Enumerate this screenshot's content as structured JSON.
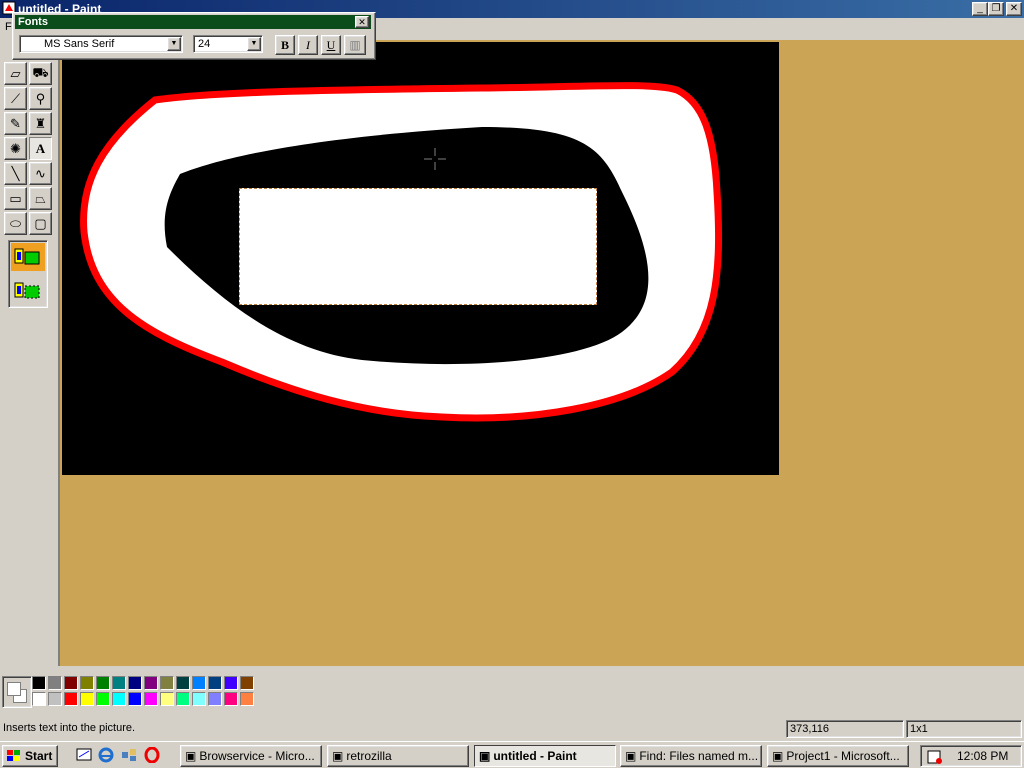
{
  "window": {
    "title": "untitled - Paint",
    "menu_first_letter": "F"
  },
  "fonts_toolbar": {
    "title": "Fonts",
    "font_name": "MS Sans Serif",
    "font_size": "24",
    "bold_label": "B",
    "italic_label": "I",
    "underline_label": "U"
  },
  "palette": {
    "row1": [
      "#000000",
      "#808080",
      "#800000",
      "#808000",
      "#008000",
      "#008080",
      "#000080",
      "#800080",
      "#808040",
      "#004040",
      "#0080ff",
      "#004080",
      "#4000ff",
      "#804000"
    ],
    "row2": [
      "#ffffff",
      "#c0c0c0",
      "#ff0000",
      "#ffff00",
      "#00ff00",
      "#00ffff",
      "#0000ff",
      "#ff00ff",
      "#ffff80",
      "#00ff80",
      "#80ffff",
      "#8080ff",
      "#ff0080",
      "#ff8040"
    ]
  },
  "status": {
    "message": "Inserts text into the picture.",
    "coords": "373,116",
    "size": "1x1"
  },
  "taskbar": {
    "start_label": "Start",
    "tasks": [
      {
        "label": "Browservice - Micro...",
        "active": false
      },
      {
        "label": "retrozilla",
        "active": false
      },
      {
        "label": "untitled - Paint",
        "active": true
      },
      {
        "label": "Find: Files named m...",
        "active": false
      },
      {
        "label": "Project1 - Microsoft...",
        "active": false
      }
    ],
    "clock": "12:08 PM"
  },
  "colors": {
    "workspace_bg": "#cca456",
    "canvas_bg": "#000000",
    "stroke_red": "#ff0000",
    "fill_white": "#ffffff"
  }
}
